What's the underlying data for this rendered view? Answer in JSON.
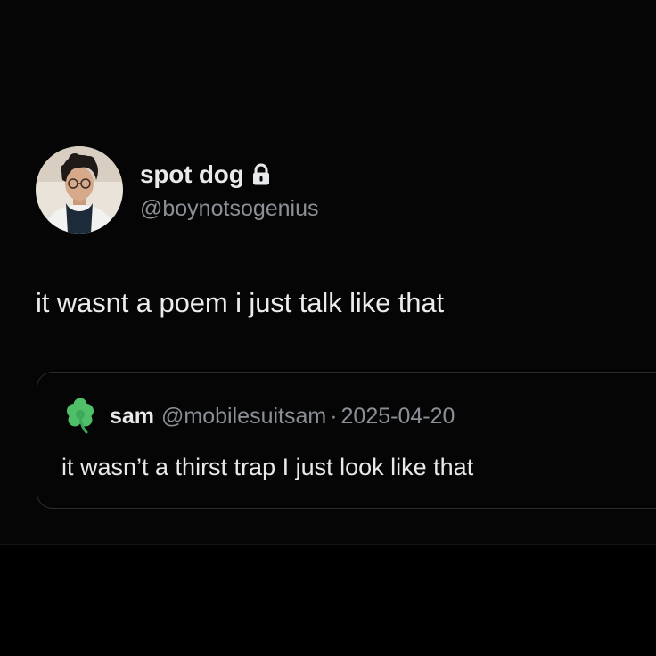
{
  "tweet": {
    "author": {
      "name": "spot dog",
      "handle": "@boynotsogenius",
      "avatar": "profile-photo",
      "lock_icon": "lock-icon"
    },
    "text": "it wasnt a poem i just talk like that",
    "quote": {
      "icon": "shamrock-icon",
      "name": "sam",
      "handle": "@mobilesuitsam",
      "separator": "·",
      "date": "2025-04-20",
      "text": "it wasn’t a thirst trap I just look like that"
    }
  },
  "colors": {
    "background": "#000000",
    "primary_text": "#e7e9ea",
    "secondary_text": "#8b9096",
    "quote_border": "#2a2d30",
    "clover_green": "#4fbf6a"
  }
}
